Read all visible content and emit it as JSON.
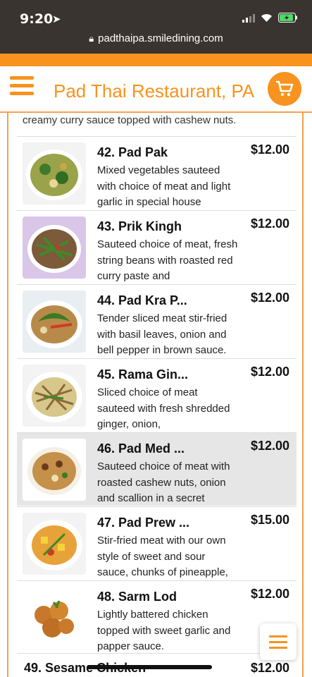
{
  "status_bar": {
    "time": "9:20",
    "url": "padthaipa.smiledining.com"
  },
  "header": {
    "title": "Pad Thai Restaurant, PA"
  },
  "menu": {
    "partial_desc": "creamy curry sauce topped with cashew nuts.",
    "items": [
      {
        "name": "42. Pad Pak",
        "desc": "Mixed vegetables sauteed with choice of meat and light garlic in special house",
        "price": "$12.00"
      },
      {
        "name": "43. Prik Kingh",
        "desc": "Sauteed choice of meat, fresh string beans with roasted red curry paste and",
        "price": "$12.00"
      },
      {
        "name": "44. Pad Kra P...",
        "desc": "Tender sliced meat stir-fried with basil leaves, onion and bell pepper in brown sauce.",
        "price": "$12.00"
      },
      {
        "name": "45. Rama Gin...",
        "desc": "Sliced choice of meat sauteed with fresh shredded ginger, onion,",
        "price": "$12.00"
      },
      {
        "name": "46. Pad Med ...",
        "desc": "Sauteed choice of meat with roasted cashew nuts, onion and scallion in a secret",
        "price": "$12.00"
      },
      {
        "name": "47. Pad Prew ...",
        "desc": "Stir-fried meat with our own style of sweet and sour sauce, chunks of pineapple,",
        "price": "$15.00"
      },
      {
        "name": "48. Sarm Lod",
        "desc": "Lightly battered chicken topped with sweet garlic and papper sauce.",
        "price": "$12.00"
      }
    ],
    "last": {
      "name": "49. Sesame Chicken",
      "price": "$12.00"
    }
  },
  "colors": {
    "accent": "#f7931e",
    "status_bar_bg": "#3a3430",
    "highlight_row": "#e6e6e6"
  },
  "icons": {
    "menu": "hamburger-icon",
    "cart": "cart-icon",
    "lock": "lock-icon",
    "location": "location-arrow-icon"
  }
}
